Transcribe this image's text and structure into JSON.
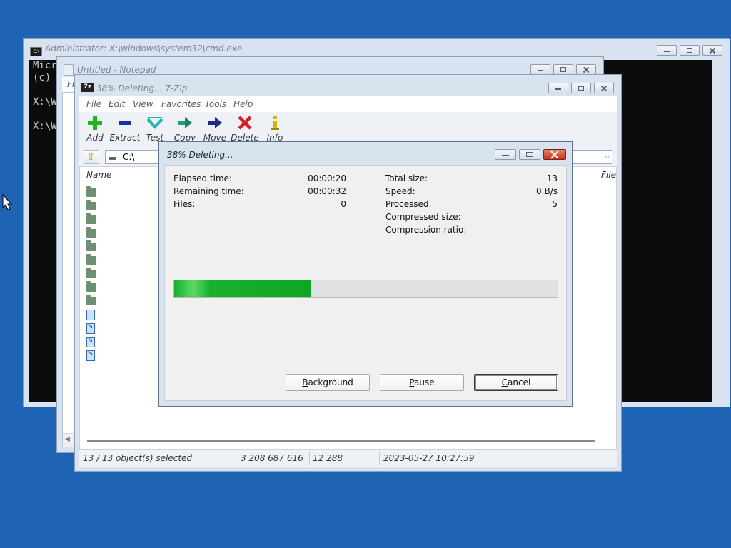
{
  "cmd": {
    "title": "Administrator: X:\\windows\\system32\\cmd.exe",
    "lines": [
      "Micro",
      "(c) M",
      "",
      "X:\\Wi",
      "",
      "X:\\Wi"
    ]
  },
  "notepad": {
    "title": "Untitled - Notepad",
    "menu_partial": "Fi"
  },
  "zip": {
    "title": "38% Deleting... 7-Zip",
    "menu": [
      "File",
      "Edit",
      "View",
      "Favorites",
      "Tools",
      "Help"
    ],
    "toolbar": [
      {
        "label": "Add",
        "icon": "plus-icon",
        "color": "#1fb51f"
      },
      {
        "label": "Extract",
        "icon": "minus-icon",
        "color": "#1a2fa8"
      },
      {
        "label": "Test",
        "icon": "check-icon",
        "color": "#1fb5b5"
      },
      {
        "label": "Copy",
        "icon": "copy-arrow-icon",
        "color": "#1f9f6f"
      },
      {
        "label": "Move",
        "icon": "move-arrow-icon",
        "color": "#1a2a8f"
      },
      {
        "label": "Delete",
        "icon": "delete-x-icon",
        "color": "#d42020"
      },
      {
        "label": "Info",
        "icon": "info-icon",
        "color": "#d4b800"
      }
    ],
    "address": "C:\\",
    "columns": {
      "name": "Name",
      "right": "File"
    },
    "status": {
      "selected": "13 / 13 object(s) selected",
      "size": "3 208 687 616",
      "packed": "12 288",
      "modified": "2023-05-27 10:27:59"
    }
  },
  "dialog": {
    "title": "38% Deleting...",
    "left_stats": [
      {
        "label": "Elapsed time:",
        "value": "00:00:20"
      },
      {
        "label": "Remaining time:",
        "value": "00:00:32"
      },
      {
        "label": "Files:",
        "value": "0"
      }
    ],
    "right_stats": [
      {
        "label": "Total size:",
        "value": "13"
      },
      {
        "label": "Speed:",
        "value": "0 B/s"
      },
      {
        "label": "Processed:",
        "value": "5"
      },
      {
        "label": "Compressed size:",
        "value": ""
      },
      {
        "label": "Compression ratio:",
        "value": ""
      }
    ],
    "progress_percent": 38,
    "buttons": {
      "background": "Background",
      "pause": "Pause",
      "cancel": "Cancel"
    }
  }
}
